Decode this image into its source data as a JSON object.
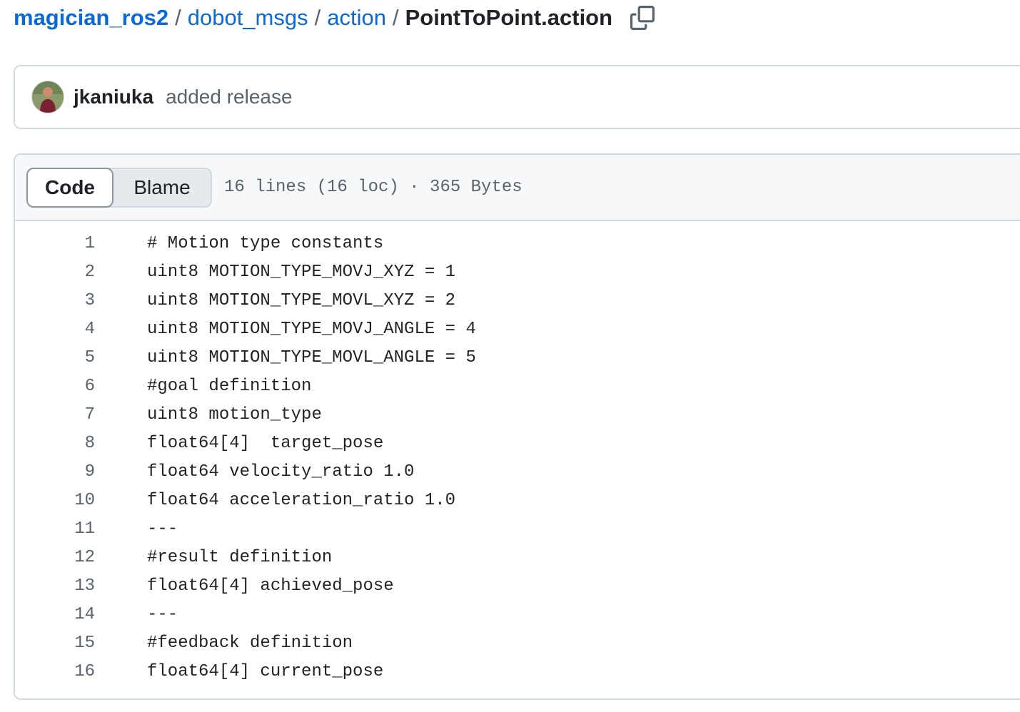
{
  "breadcrumb": {
    "repo": "magician_ros2",
    "sep1": "/",
    "folder1": "dobot_msgs",
    "sep2": "/",
    "folder2": "action",
    "sep3": "/",
    "file": "PointToPoint.action"
  },
  "commit": {
    "author": "jkaniuka",
    "message": "added release"
  },
  "file_header": {
    "tabs": [
      "Code",
      "Blame"
    ],
    "active_tab": "Code",
    "info": "16 lines (16 loc) · 365 Bytes"
  },
  "code": {
    "lines": [
      {
        "num": "1",
        "text": "# Motion type constants"
      },
      {
        "num": "2",
        "text": "uint8 MOTION_TYPE_MOVJ_XYZ = 1"
      },
      {
        "num": "3",
        "text": "uint8 MOTION_TYPE_MOVL_XYZ = 2"
      },
      {
        "num": "4",
        "text": "uint8 MOTION_TYPE_MOVJ_ANGLE = 4"
      },
      {
        "num": "5",
        "text": "uint8 MOTION_TYPE_MOVL_ANGLE = 5"
      },
      {
        "num": "6",
        "text": "#goal definition"
      },
      {
        "num": "7",
        "text": "uint8 motion_type"
      },
      {
        "num": "8",
        "text": "float64[4]  target_pose"
      },
      {
        "num": "9",
        "text": "float64 velocity_ratio 1.0"
      },
      {
        "num": "10",
        "text": "float64 acceleration_ratio 1.0"
      },
      {
        "num": "11",
        "text": "---"
      },
      {
        "num": "12",
        "text": "#result definition"
      },
      {
        "num": "13",
        "text": "float64[4] achieved_pose"
      },
      {
        "num": "14",
        "text": "---"
      },
      {
        "num": "15",
        "text": "#feedback definition"
      },
      {
        "num": "16",
        "text": "float64[4] current_pose"
      }
    ]
  },
  "colors": {
    "link": "#0969da",
    "text": "#1f2328",
    "muted": "#59636e",
    "border": "#d1d9e0",
    "header_bg": "#f6f8fa"
  },
  "icons": {
    "copy": "copy-icon",
    "avatar": "avatar"
  }
}
